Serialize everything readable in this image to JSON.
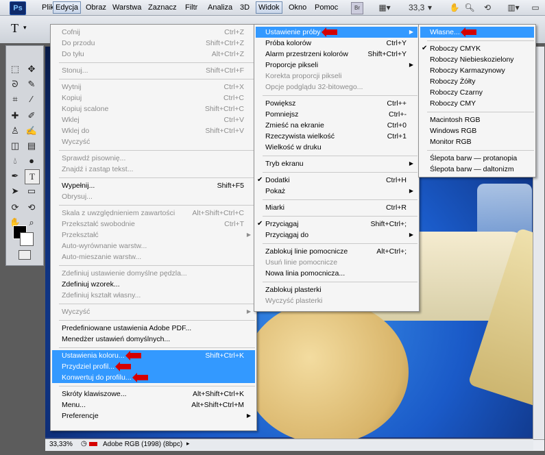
{
  "app": {
    "logo": "Ps"
  },
  "menubar": {
    "items": [
      "Plik",
      "Edycja",
      "Obraz",
      "Warstwa",
      "Zaznacz",
      "Filtr",
      "Analiza",
      "3D",
      "Widok",
      "Okno",
      "Pomoc"
    ],
    "zoom": "33,3",
    "zoom_arrow": "▾"
  },
  "edit_menu": {
    "rows": [
      {
        "label": "Cofnij",
        "sc": "Ctrl+Z",
        "dis": true
      },
      {
        "label": "Do przodu",
        "sc": "Shift+Ctrl+Z",
        "dis": true
      },
      {
        "label": "Do tyłu",
        "sc": "Alt+Ctrl+Z",
        "dis": true
      },
      {
        "sep": true
      },
      {
        "label": "Stonuj...",
        "sc": "Shift+Ctrl+F",
        "dis": true
      },
      {
        "sep": true
      },
      {
        "label": "Wytnij",
        "sc": "Ctrl+X",
        "dis": true
      },
      {
        "label": "Kopiuj",
        "sc": "Ctrl+C",
        "dis": true
      },
      {
        "label": "Kopiuj scalone",
        "sc": "Shift+Ctrl+C",
        "dis": true
      },
      {
        "label": "Wklej",
        "sc": "Ctrl+V",
        "dis": true
      },
      {
        "label": "Wklej do",
        "sc": "Shift+Ctrl+V",
        "dis": true
      },
      {
        "label": "Wyczyść",
        "sc": "",
        "dis": true
      },
      {
        "sep": true
      },
      {
        "label": "Sprawdź pisownię...",
        "sc": "",
        "dis": true
      },
      {
        "label": "Znajdź i zastąp tekst...",
        "sc": "",
        "dis": true
      },
      {
        "sep": true
      },
      {
        "label": "Wypełnij...",
        "sc": "Shift+F5"
      },
      {
        "label": "Obrysuj...",
        "sc": "",
        "dis": true
      },
      {
        "sep": true
      },
      {
        "label": "Skala z uwzględnieniem zawartości",
        "sc": "Alt+Shift+Ctrl+C",
        "dis": true
      },
      {
        "label": "Przekształć swobodnie",
        "sc": "Ctrl+T",
        "dis": true
      },
      {
        "label": "Przekształć",
        "sc": "",
        "dis": true,
        "sub": true
      },
      {
        "label": "Auto-wyrównanie warstw...",
        "sc": "",
        "dis": true
      },
      {
        "label": "Auto-mieszanie warstw...",
        "sc": "",
        "dis": true
      },
      {
        "sep": true
      },
      {
        "label": "Zdefiniuj ustawienie domyślne pędzla...",
        "sc": "",
        "dis": true
      },
      {
        "label": "Zdefiniuj wzorek...",
        "sc": ""
      },
      {
        "label": "Zdefiniuj kształt własny...",
        "sc": "",
        "dis": true
      },
      {
        "sep": true
      },
      {
        "label": "Wyczyść",
        "sc": "",
        "dis": true,
        "sub": true
      },
      {
        "sep": true
      },
      {
        "label": "Predefiniowane ustawienia Adobe PDF...",
        "sc": ""
      },
      {
        "label": "Menedżer ustawień domyślnych...",
        "sc": ""
      },
      {
        "sep": true
      },
      {
        "label": "Ustawienia koloru...",
        "sc": "Shift+Ctrl+K",
        "hl": true,
        "arrow": true
      },
      {
        "label": "Przydziel profil...",
        "sc": "",
        "hl": true,
        "arrow": true
      },
      {
        "label": "Konwertuj do profilu...",
        "sc": "",
        "hl": true,
        "arrow": true
      },
      {
        "sep": true
      },
      {
        "label": "Skróty klawiszowe...",
        "sc": "Alt+Shift+Ctrl+K"
      },
      {
        "label": "Menu...",
        "sc": "Alt+Shift+Ctrl+M"
      },
      {
        "label": "Preferencje",
        "sc": "",
        "sub": true
      }
    ]
  },
  "view_menu": {
    "rows": [
      {
        "label": "Ustawienie próby",
        "sc": "",
        "hl": true,
        "sub": true,
        "arrow": true
      },
      {
        "label": "Próba kolorów",
        "sc": "Ctrl+Y"
      },
      {
        "label": "Alarm przestrzeni kolorów",
        "sc": "Shift+Ctrl+Y"
      },
      {
        "label": "Proporcje pikseli",
        "sc": "",
        "sub": true
      },
      {
        "label": "Korekta proporcji pikseli",
        "sc": "",
        "dis": true
      },
      {
        "label": "Opcje podglądu 32-bitowego...",
        "sc": "",
        "dis": true
      },
      {
        "sep": true
      },
      {
        "label": "Powiększ",
        "sc": "Ctrl++"
      },
      {
        "label": "Pomniejsz",
        "sc": "Ctrl+-"
      },
      {
        "label": "Zmieść na ekranie",
        "sc": "Ctrl+0"
      },
      {
        "label": "Rzeczywista wielkość",
        "sc": "Ctrl+1"
      },
      {
        "label": "Wielkość w druku",
        "sc": ""
      },
      {
        "sep": true
      },
      {
        "label": "Tryb ekranu",
        "sc": "",
        "sub": true
      },
      {
        "sep": true
      },
      {
        "label": "Dodatki",
        "sc": "Ctrl+H",
        "chk": true
      },
      {
        "label": "Pokaż",
        "sc": "",
        "sub": true
      },
      {
        "sep": true
      },
      {
        "label": "Miarki",
        "sc": "Ctrl+R"
      },
      {
        "sep": true
      },
      {
        "label": "Przyciągaj",
        "sc": "Shift+Ctrl+;",
        "chk": true
      },
      {
        "label": "Przyciągaj do",
        "sc": "",
        "sub": true
      },
      {
        "sep": true
      },
      {
        "label": "Zablokuj linie pomocnicze",
        "sc": "Alt+Ctrl+;"
      },
      {
        "label": "Usuń linie pomocnicze",
        "sc": "",
        "dis": true
      },
      {
        "label": "Nowa linia pomocnicza...",
        "sc": ""
      },
      {
        "sep": true
      },
      {
        "label": "Zablokuj plasterki",
        "sc": ""
      },
      {
        "label": "Wyczyść plasterki",
        "sc": "",
        "dis": true
      }
    ]
  },
  "proof_menu": {
    "rows": [
      {
        "label": "Własne...",
        "hl": true,
        "arrow": true
      },
      {
        "sep": true
      },
      {
        "label": "Roboczy CMYK",
        "chk": true
      },
      {
        "label": "Roboczy Niebieskozielony"
      },
      {
        "label": "Roboczy Karmazynowy"
      },
      {
        "label": "Roboczy Żółty"
      },
      {
        "label": "Roboczy Czarny"
      },
      {
        "label": "Roboczy CMY"
      },
      {
        "sep": true
      },
      {
        "label": "Macintosh RGB"
      },
      {
        "label": "Windows RGB"
      },
      {
        "label": "Monitor RGB"
      },
      {
        "sep": true
      },
      {
        "label": "Ślepota barw — protanopia"
      },
      {
        "label": "Ślepota barw — daltonizm"
      }
    ]
  },
  "status": {
    "zoom": "33,33%",
    "profile": "Adobe RGB (1998) (8bpc)"
  },
  "colors": {
    "highlight": "#3399ff",
    "arrow": "#d40000"
  }
}
